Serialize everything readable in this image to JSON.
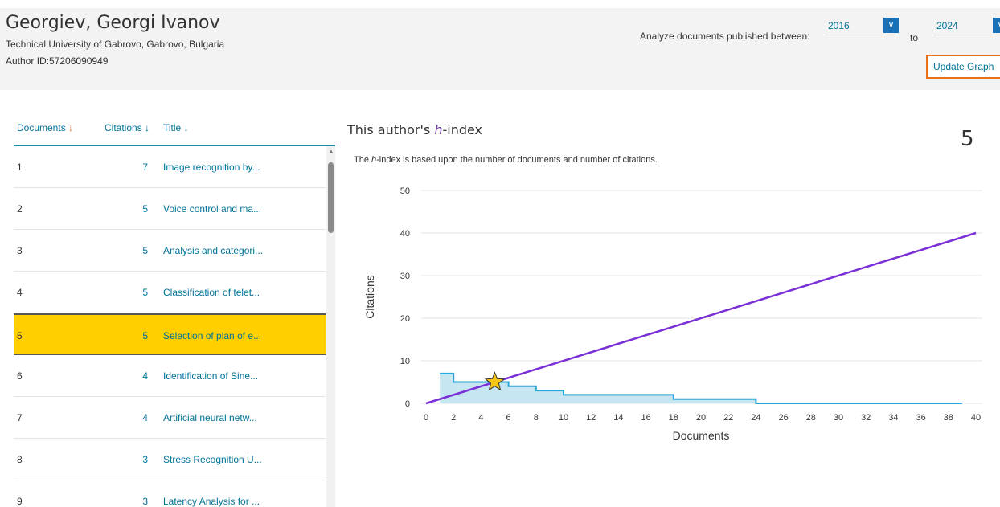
{
  "author": {
    "name": "Georgiev, Georgi Ivanov",
    "affiliation": "Technical University of Gabrovo, Gabrovo, Bulgaria",
    "author_id": "Author ID:57206090949"
  },
  "filter": {
    "label": "Analyze documents published between:",
    "from_year": "2016",
    "to_label": "to",
    "to_year": "2024",
    "update_button": "Update Graph"
  },
  "table": {
    "headers": {
      "documents": "Documents",
      "citations": "Citations",
      "title": "Title"
    },
    "rows": [
      {
        "doc": "1",
        "citations": "7",
        "title": "Image recognition by..."
      },
      {
        "doc": "2",
        "citations": "5",
        "title": "Voice control and ma..."
      },
      {
        "doc": "3",
        "citations": "5",
        "title": "Analysis and categori..."
      },
      {
        "doc": "4",
        "citations": "5",
        "title": "Classification of telet..."
      },
      {
        "doc": "5",
        "citations": "5",
        "title": "Selection of plan of e..."
      },
      {
        "doc": "6",
        "citations": "4",
        "title": "Identification of Sine..."
      },
      {
        "doc": "7",
        "citations": "4",
        "title": "Artificial neural netw..."
      },
      {
        "doc": "8",
        "citations": "3",
        "title": "Stress Recognition U..."
      },
      {
        "doc": "9",
        "citations": "3",
        "title": "Latency Analysis for ..."
      }
    ],
    "highlighted_row": 4
  },
  "hindex": {
    "title_prefix": "This author's ",
    "title_h": "h",
    "title_suffix": "-index",
    "value": "5",
    "desc_prefix": "The ",
    "desc_h": "h",
    "desc_suffix": "-index is based upon the number of documents and number of citations."
  },
  "colors": {
    "accent_link": "#007398",
    "highlight": "#ffcf00",
    "diagonal_line": "#7b2fd6",
    "area_fill": "#c6e6f2",
    "area_line": "#2aa6d8",
    "star": "#f5c518",
    "update_border": "#e9711c"
  },
  "chart_data": {
    "type": "area",
    "xlabel": "Documents",
    "ylabel": "Citations",
    "xlim": [
      0,
      40
    ],
    "ylim": [
      0,
      50
    ],
    "xticks": [
      0,
      2,
      4,
      6,
      8,
      10,
      12,
      14,
      16,
      18,
      20,
      22,
      24,
      26,
      28,
      30,
      32,
      34,
      36,
      38,
      40
    ],
    "yticks": [
      0,
      10,
      20,
      30,
      40,
      50
    ],
    "grid": true,
    "series": [
      {
        "x": [
          1,
          2,
          3,
          4,
          5,
          6,
          7,
          8,
          9,
          10,
          11,
          12,
          13,
          14,
          15,
          16,
          17,
          18,
          19,
          20,
          21,
          22,
          23,
          24,
          25,
          26,
          27,
          28,
          29,
          30,
          31,
          32,
          33,
          34,
          35,
          36,
          37,
          38,
          39
        ],
        "values": [
          7,
          5,
          5,
          5,
          5,
          4,
          4,
          3,
          3,
          2,
          2,
          2,
          2,
          2,
          2,
          2,
          2,
          1,
          1,
          1,
          1,
          1,
          1,
          0,
          0,
          0,
          0,
          0,
          0,
          0,
          0,
          0,
          0,
          0,
          0,
          0,
          0,
          0,
          0
        ]
      }
    ],
    "diagonal": {
      "x": [
        0,
        40
      ],
      "y": [
        0,
        40
      ]
    },
    "h_index_marker": {
      "x": 5,
      "y": 5
    }
  }
}
